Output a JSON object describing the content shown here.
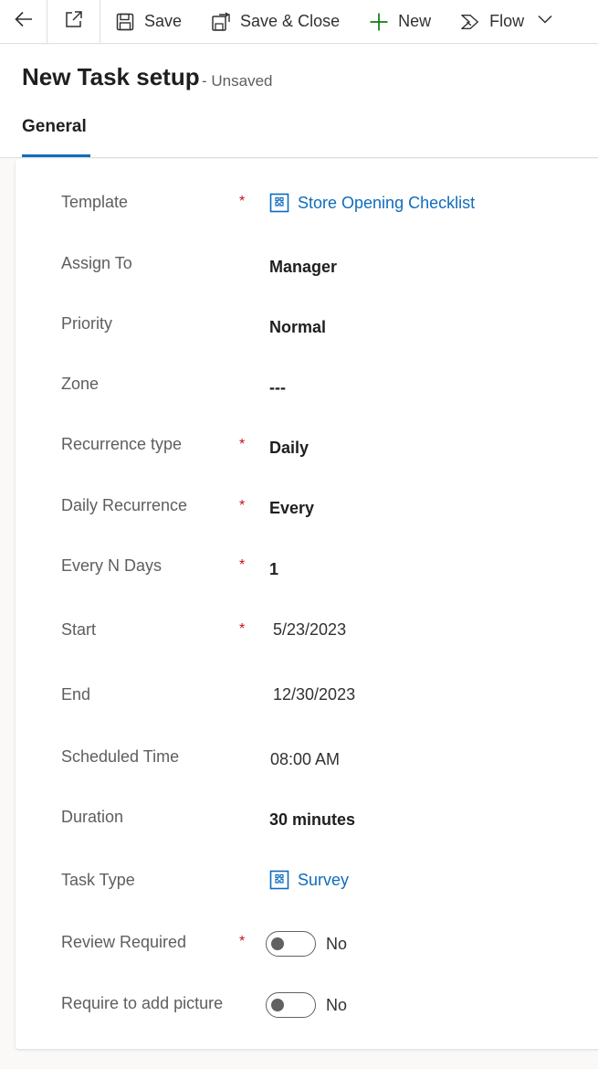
{
  "toolbar": {
    "save_label": "Save",
    "save_close_label": "Save & Close",
    "new_label": "New",
    "flow_label": "Flow",
    "icons": [
      "back-arrow-icon",
      "popout-icon",
      "save-icon",
      "save-close-icon",
      "plus-icon",
      "flow-icon",
      "chevron-down-icon"
    ]
  },
  "header": {
    "title": "New Task setup",
    "status": "- Unsaved",
    "tabs": [
      {
        "label": "General"
      }
    ]
  },
  "colors": {
    "accent": "#0f6cbd",
    "required": "#c50f1f",
    "label": "#605e5c"
  },
  "form": {
    "fields": [
      {
        "label": "Template",
        "required": "*",
        "value": "Store Opening Checklist",
        "kind": "lookup"
      },
      {
        "label": "Assign To",
        "value": "Manager"
      },
      {
        "label": "Priority",
        "value": "Normal"
      },
      {
        "label": "Zone",
        "value": "---"
      },
      {
        "label": "Recurrence type",
        "required": "*",
        "value": "Daily"
      },
      {
        "label": "Daily Recurrence",
        "required": "*",
        "value": "Every"
      },
      {
        "label": "Every N Days",
        "required": "*",
        "value": "1"
      },
      {
        "label": "Start",
        "required": "*",
        "value": "5/23/2023"
      },
      {
        "label": "End",
        "value": "12/30/2023"
      },
      {
        "label": "Scheduled Time",
        "value": "08:00 AM"
      },
      {
        "label": "Duration",
        "value": "30 minutes"
      },
      {
        "label": "Task Type",
        "value": "Survey",
        "kind": "lookup"
      },
      {
        "label": "Review Required",
        "required": "*",
        "value": "No",
        "kind": "toggle",
        "on": false
      },
      {
        "label": "Require to add picture",
        "value": "No",
        "kind": "toggle",
        "on": false
      }
    ]
  }
}
